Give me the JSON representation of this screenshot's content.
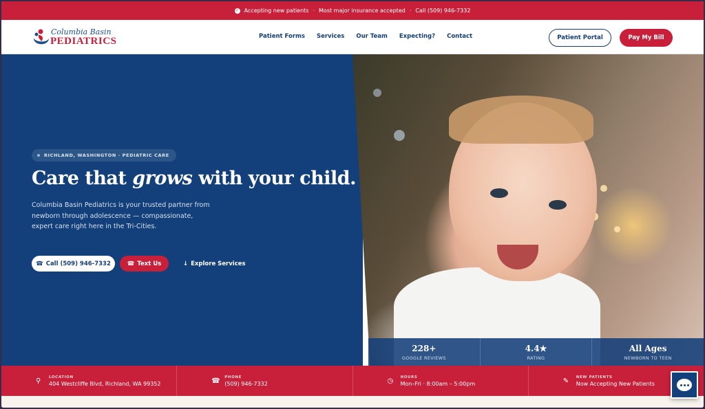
{
  "topbar": {
    "item1": "Accepting new patients",
    "item2": "Most major insurance accepted",
    "item3": "Call (509) 946-7332",
    "separator": "·"
  },
  "brand": {
    "line1": "Columbia Basin",
    "line2": "PEDIATRICS",
    "colors": {
      "navy": "#133f7a",
      "red": "#c8203a"
    }
  },
  "nav": {
    "items": [
      "Patient Forms",
      "Services",
      "Our Team",
      "Expecting?",
      "Contact"
    ],
    "portal_label": "Patient Portal",
    "bill_label": "Pay My Bill"
  },
  "hero": {
    "badge": "RICHLAND, WASHINGTON · PEDIATRIC CARE",
    "headline_pre": "Care that ",
    "headline_em": "grows",
    "headline_post": " with your child.",
    "lede": "Columbia Basin Pediatrics is your trusted partner from newborn through adolescence — compassionate, expert care right here in the Tri-Cities.",
    "cta_call": "Call (509) 946-7332",
    "cta_text": "Text Us",
    "cta_explore": "Explore Services"
  },
  "stats": [
    {
      "value": "228+",
      "label": "GOOGLE REVIEWS"
    },
    {
      "value": "4.4★",
      "label": "RATING"
    },
    {
      "value": "All Ages",
      "label": "NEWBORN TO TEEN"
    }
  ],
  "info": [
    {
      "icon": "location-pin-icon",
      "key": "LOCATION",
      "value": "404 Westcliffe Blvd, Richland, WA 99352"
    },
    {
      "icon": "phone-icon",
      "key": "PHONE",
      "value": "(509) 946-7332"
    },
    {
      "icon": "clock-icon",
      "key": "HOURS",
      "value": "Mon–Fri · 8:00am – 5:00pm"
    },
    {
      "icon": "new-patient-icon",
      "key": "NEW PATIENTS",
      "value": "Now Accepting New Patients"
    }
  ],
  "chat": {
    "icon": "chat-icon"
  }
}
